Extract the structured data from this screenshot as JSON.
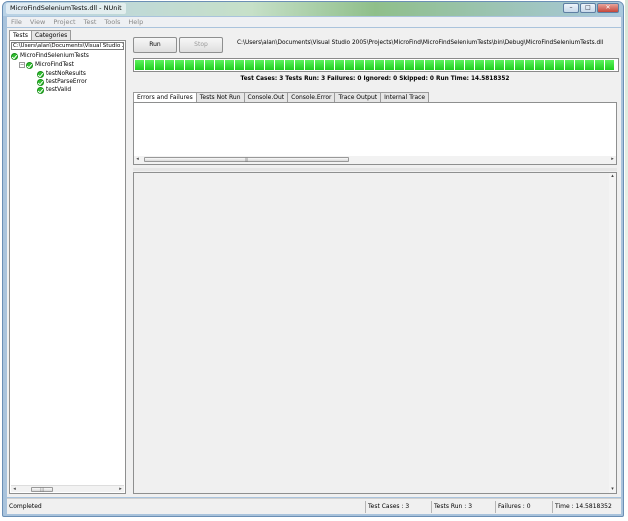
{
  "window": {
    "title": "MicroFindSeleniumTests.dll - NUnit",
    "controls": [
      "minimize-icon",
      "maximize-icon",
      "close-icon"
    ],
    "control_glyphs": {
      "minimize": "–",
      "maximize": "□",
      "close": "✕"
    }
  },
  "menu": {
    "file": "File",
    "view": "View",
    "project": "Project",
    "test": "Test",
    "tools": "Tools",
    "help": "Help"
  },
  "left_panel": {
    "tabs": {
      "tests": "Tests",
      "categories": "Categories"
    },
    "path": "C:\\Users\\alan\\Documents\\Visual Studio 20",
    "tree": {
      "root": "MicroFindSeleniumTests",
      "fixture": "MicroFindTest",
      "tests": [
        "testNoResults",
        "testParseError",
        "testValid"
      ]
    }
  },
  "toolbar": {
    "run_label": "Run",
    "stop_label": "Stop",
    "assembly_path": "C:\\Users\\alan\\Documents\\Visual Studio 2005\\Projects\\MicroFind\\MicroFindSeleniumTests\\bin\\Debug\\MicroFindSeleniumTests.dll"
  },
  "progress": {
    "fraction": 1.0,
    "color": "#22cc22"
  },
  "summary": "Test Cases: 3   Tests Run: 3   Failures: 0   Ignored: 0   Skipped: 0   Run Time: 14.5818352",
  "result_tabs": [
    "Errors and Failures",
    "Tests Not Run",
    "Console.Out",
    "Console.Error",
    "Trace Output",
    "Internal Trace"
  ],
  "status_bar": {
    "state": "Completed",
    "test_cases": "Test Cases : 3",
    "tests_run": "Tests Run : 3",
    "failures": "Failures : 0",
    "time": "Time : 14.5818352"
  },
  "colors": {
    "success": "#2fbf2f",
    "progress_green": "#22cc22"
  }
}
